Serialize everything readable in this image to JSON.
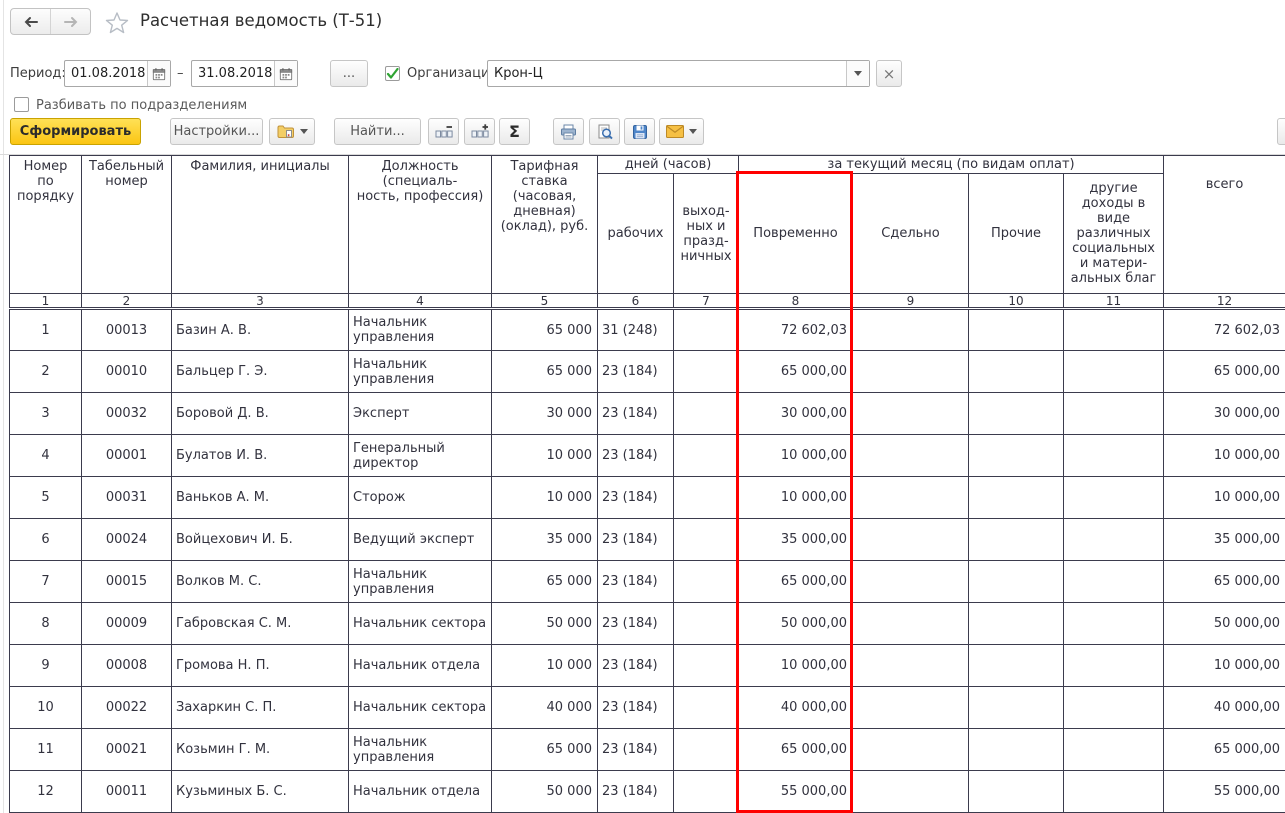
{
  "window": {
    "title": "Расчетная ведомость (Т-51)"
  },
  "filters": {
    "period_label": "Период:",
    "period_from": "01.08.2018",
    "period_to": "31.08.2018",
    "range_dash": "–",
    "period_more_label": "...",
    "organization_label": "Организация:",
    "organization_value": "Крон-Ц",
    "organization_checked": true,
    "clear_label": "×",
    "split_label": "Разбивать по подразделениям",
    "split_checked": false
  },
  "toolbar": {
    "generate_label": "Сформировать",
    "settings_label": "Настройки...",
    "find_label": "Найти...",
    "sum_label": "Σ"
  },
  "colors": {
    "highlight_red": "#ff0000",
    "generate_button_yellow": "#fbc513",
    "check_green": "#2fa433",
    "grid": "#3b3b4d"
  },
  "table": {
    "headers": {
      "row_number": "Номер\nпо\nпорядку",
      "personnel_number": "Табельный\nномер",
      "full_name": "Фамилия, инициалы",
      "position": "Должность\n(специаль-\nность, профессия)",
      "rate": "Тарифная\nставка\n(часовая,\nдневная)\n(оклад), руб.",
      "days_group": "дней (часов)",
      "days_worked": "рабочих",
      "days_off": "выход-\nных и\nпразд-\nничных",
      "month_group": "за текущий месяц (по видам оплат)",
      "time_payment": "Повременно",
      "piecework": "Сдельно",
      "other": "Прочие",
      "other_income": "другие\nдоходы в\nвиде\nразличных\nсоциальных\nи матери-\nальных благ",
      "total": "всего"
    },
    "column_numbers": [
      "1",
      "2",
      "3",
      "4",
      "5",
      "6",
      "7",
      "8",
      "9",
      "10",
      "11",
      "12"
    ],
    "rows": [
      {
        "n": "1",
        "tab": "00013",
        "name": "Базин А. В.",
        "position": "Начальник\nуправления",
        "rate": "65 000",
        "days": "31 (248)",
        "holidays": "",
        "time": "72 602,03",
        "piece": "",
        "other": "",
        "social": "",
        "total": "72 602,03"
      },
      {
        "n": "2",
        "tab": "00010",
        "name": "Бальцер Г. Э.",
        "position": "Начальник\nуправления",
        "rate": "65 000",
        "days": "23 (184)",
        "holidays": "",
        "time": "65 000,00",
        "piece": "",
        "other": "",
        "social": "",
        "total": "65 000,00"
      },
      {
        "n": "3",
        "tab": "00032",
        "name": "Боровой Д. В.",
        "position": "Эксперт",
        "rate": "30 000",
        "days": "23 (184)",
        "holidays": "",
        "time": "30 000,00",
        "piece": "",
        "other": "",
        "social": "",
        "total": "30 000,00"
      },
      {
        "n": "4",
        "tab": "00001",
        "name": "Булатов И. В.",
        "position": "Генеральный\nдиректор",
        "rate": "10 000",
        "days": "23 (184)",
        "holidays": "",
        "time": "10 000,00",
        "piece": "",
        "other": "",
        "social": "",
        "total": "10 000,00"
      },
      {
        "n": "5",
        "tab": "00031",
        "name": "Ваньков А. М.",
        "position": "Сторож",
        "rate": "10 000",
        "days": "23 (184)",
        "holidays": "",
        "time": "10 000,00",
        "piece": "",
        "other": "",
        "social": "",
        "total": "10 000,00"
      },
      {
        "n": "6",
        "tab": "00024",
        "name": "Войцехович И. Б.",
        "position": "Ведущий эксперт",
        "rate": "35 000",
        "days": "23 (184)",
        "holidays": "",
        "time": "35 000,00",
        "piece": "",
        "other": "",
        "social": "",
        "total": "35 000,00"
      },
      {
        "n": "7",
        "tab": "00015",
        "name": "Волков М. С.",
        "position": "Начальник\nуправления",
        "rate": "65 000",
        "days": "23 (184)",
        "holidays": "",
        "time": "65 000,00",
        "piece": "",
        "other": "",
        "social": "",
        "total": "65 000,00"
      },
      {
        "n": "8",
        "tab": "00009",
        "name": "Габровская С. М.",
        "position": "Начальник сектора",
        "rate": "50 000",
        "days": "23 (184)",
        "holidays": "",
        "time": "50 000,00",
        "piece": "",
        "other": "",
        "social": "",
        "total": "50 000,00"
      },
      {
        "n": "9",
        "tab": "00008",
        "name": "Громова Н. П.",
        "position": "Начальник отдела",
        "rate": "10 000",
        "days": "23 (184)",
        "holidays": "",
        "time": "10 000,00",
        "piece": "",
        "other": "",
        "social": "",
        "total": "10 000,00"
      },
      {
        "n": "10",
        "tab": "00022",
        "name": "Захаркин С. П.",
        "position": "Начальник сектора",
        "rate": "40 000",
        "days": "23 (184)",
        "holidays": "",
        "time": "40 000,00",
        "piece": "",
        "other": "",
        "social": "",
        "total": "40 000,00"
      },
      {
        "n": "11",
        "tab": "00021",
        "name": "Козьмин Г. М.",
        "position": "Начальник\nуправления",
        "rate": "65 000",
        "days": "23 (184)",
        "holidays": "",
        "time": "65 000,00",
        "piece": "",
        "other": "",
        "social": "",
        "total": "65 000,00"
      },
      {
        "n": "12",
        "tab": "00011",
        "name": "Кузьминых Б. С.",
        "position": "Начальник отдела",
        "rate": "50 000",
        "days": "23 (184)",
        "holidays": "",
        "time": "55 000,00",
        "piece": "",
        "other": "",
        "social": "",
        "total": "55 000,00"
      }
    ]
  }
}
